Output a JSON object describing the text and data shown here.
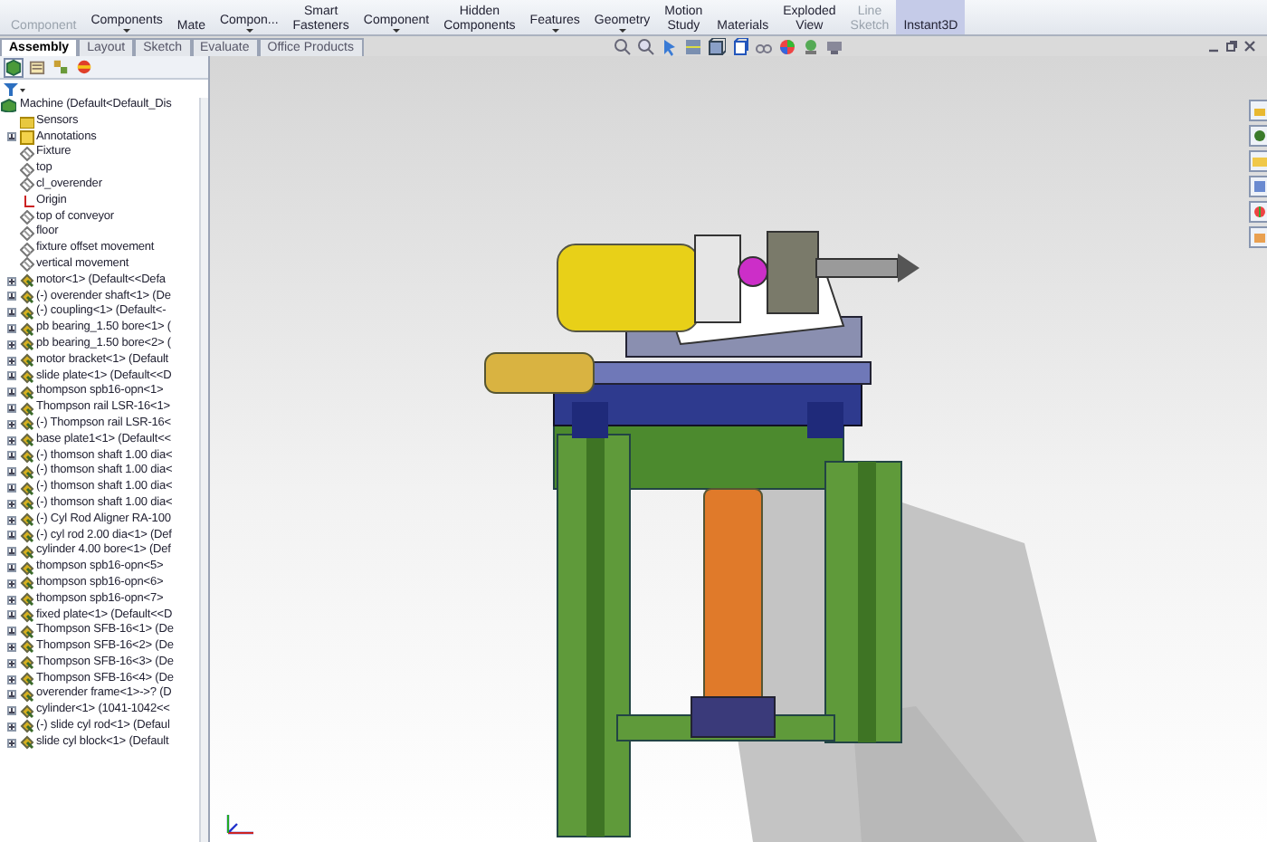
{
  "toolbar": {
    "buttons": [
      {
        "lines": [
          "Component"
        ],
        "dropdown": false,
        "disabled": true,
        "selected": false
      },
      {
        "lines": [
          "Components"
        ],
        "dropdown": true,
        "disabled": false,
        "selected": false
      },
      {
        "lines": [
          "Mate"
        ],
        "dropdown": false,
        "disabled": false,
        "selected": false
      },
      {
        "lines": [
          "Compon..."
        ],
        "dropdown": true,
        "disabled": false,
        "selected": false
      },
      {
        "lines": [
          "Smart",
          "Fasteners"
        ],
        "dropdown": false,
        "disabled": false,
        "selected": false
      },
      {
        "lines": [
          "Component"
        ],
        "dropdown": true,
        "disabled": false,
        "selected": false
      },
      {
        "lines": [
          "Hidden",
          "Components"
        ],
        "dropdown": false,
        "disabled": false,
        "selected": false
      },
      {
        "lines": [
          "Features"
        ],
        "dropdown": true,
        "disabled": false,
        "selected": false
      },
      {
        "lines": [
          "Geometry"
        ],
        "dropdown": true,
        "disabled": false,
        "selected": false
      },
      {
        "lines": [
          "Motion",
          "Study"
        ],
        "dropdown": false,
        "disabled": false,
        "selected": false
      },
      {
        "lines": [
          "Materials"
        ],
        "dropdown": false,
        "disabled": false,
        "selected": false
      },
      {
        "lines": [
          "Exploded",
          "View"
        ],
        "dropdown": false,
        "disabled": false,
        "selected": false
      },
      {
        "lines": [
          "Line",
          "Sketch"
        ],
        "dropdown": false,
        "disabled": true,
        "selected": false
      },
      {
        "lines": [
          "Instant3D"
        ],
        "dropdown": false,
        "disabled": false,
        "selected": true
      }
    ]
  },
  "tabs": [
    {
      "label": "Assembly",
      "selected": true
    },
    {
      "label": "Layout",
      "selected": false
    },
    {
      "label": "Sketch",
      "selected": false
    },
    {
      "label": "Evaluate",
      "selected": false
    },
    {
      "label": "Office Products",
      "selected": false
    }
  ],
  "panel_tabs": [
    {
      "kind": "feature",
      "selected": true
    },
    {
      "kind": "property",
      "selected": false
    },
    {
      "kind": "configuration",
      "selected": false
    },
    {
      "kind": "appearance",
      "selected": false
    }
  ],
  "tree": {
    "label": "Machine  (Default<Default_Dis",
    "children": [
      {
        "kind": "folder",
        "label": "Sensors"
      },
      {
        "kind": "annotations",
        "label": "Annotations",
        "expanded": false
      },
      {
        "kind": "plane",
        "label": "Fixture"
      },
      {
        "kind": "plane",
        "label": "top"
      },
      {
        "kind": "plane",
        "label": "cl_overender"
      },
      {
        "kind": "origin",
        "label": "Origin"
      },
      {
        "kind": "plane",
        "label": "top of conveyor"
      },
      {
        "kind": "plane",
        "label": "floor"
      },
      {
        "kind": "plane",
        "label": "fixture offset movement"
      },
      {
        "kind": "plane",
        "label": "vertical movement"
      },
      {
        "kind": "part",
        "label": "motor<1> (Default<<Defa",
        "expanded": false
      },
      {
        "kind": "part",
        "label": "(-) overender shaft<1> (De",
        "expanded": false
      },
      {
        "kind": "part",
        "label": "(-) coupling<1> (Default<-",
        "expanded": false
      },
      {
        "kind": "part",
        "label": "pb bearing_1.50 bore<1> (",
        "expanded": false
      },
      {
        "kind": "part",
        "label": "pb bearing_1.50 bore<2> (",
        "expanded": false
      },
      {
        "kind": "part",
        "label": "motor bracket<1> (Default",
        "expanded": false
      },
      {
        "kind": "part",
        "label": "slide plate<1> (Default<<D",
        "expanded": false
      },
      {
        "kind": "part",
        "label": "thompson spb16-opn<1>",
        "expanded": false
      },
      {
        "kind": "part",
        "label": "Thompson rail LSR-16<1>",
        "expanded": false
      },
      {
        "kind": "part",
        "label": "(-) Thompson rail LSR-16<",
        "expanded": false
      },
      {
        "kind": "part",
        "label": "base plate1<1> (Default<<",
        "expanded": false
      },
      {
        "kind": "part",
        "label": "(-) thomson shaft 1.00 dia<",
        "expanded": false
      },
      {
        "kind": "part",
        "label": "(-) thomson shaft 1.00 dia<",
        "expanded": false
      },
      {
        "kind": "part",
        "label": "(-) thomson shaft 1.00 dia<",
        "expanded": false
      },
      {
        "kind": "part",
        "label": "(-) thomson shaft 1.00 dia<",
        "expanded": false
      },
      {
        "kind": "part",
        "label": "(-) Cyl Rod Aligner RA-100",
        "expanded": false
      },
      {
        "kind": "part",
        "label": "(-) cyl rod 2.00 dia<1> (Def",
        "expanded": false
      },
      {
        "kind": "part",
        "label": "cylinder 4.00 bore<1> (Def",
        "expanded": false
      },
      {
        "kind": "part",
        "label": "thompson spb16-opn<5>",
        "expanded": false
      },
      {
        "kind": "part",
        "label": "thompson spb16-opn<6>",
        "expanded": false
      },
      {
        "kind": "part",
        "label": "thompson spb16-opn<7>",
        "expanded": false
      },
      {
        "kind": "part",
        "label": "fixed plate<1> (Default<<D",
        "expanded": false
      },
      {
        "kind": "part",
        "label": "Thompson SFB-16<1> (De",
        "expanded": false
      },
      {
        "kind": "part",
        "label": "Thompson SFB-16<2> (De",
        "expanded": false
      },
      {
        "kind": "part",
        "label": "Thompson SFB-16<3> (De",
        "expanded": false
      },
      {
        "kind": "part",
        "label": "Thompson SFB-16<4> (De",
        "expanded": false
      },
      {
        "kind": "part",
        "label": "overender frame<1>->? (D",
        "expanded": false
      },
      {
        "kind": "part",
        "label": "cylinder<1> (1041-1042<<",
        "expanded": false
      },
      {
        "kind": "part",
        "label": "(-) slide cyl rod<1> (Defaul",
        "expanded": false
      },
      {
        "kind": "part",
        "label": "slide cyl block<1> (Default",
        "expanded": false
      }
    ]
  }
}
